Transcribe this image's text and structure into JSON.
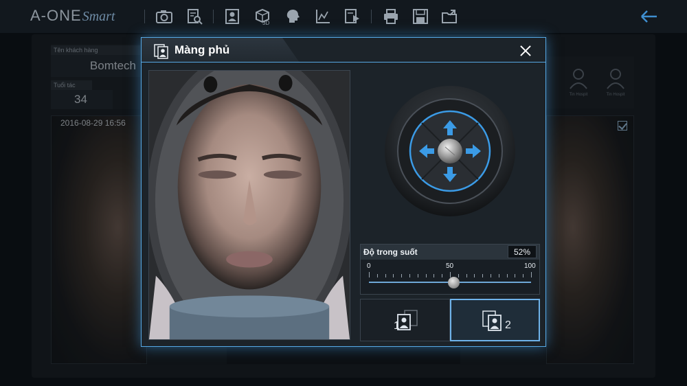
{
  "topbar": {
    "brand_main": "A-ONE",
    "brand_script": "Smart",
    "icons": [
      "camera-icon",
      "report-search-icon",
      "portrait-icon",
      "3d-cube-icon",
      "face-profile-icon",
      "chart-icon",
      "media-export-icon",
      "printer-icon",
      "save-icon",
      "open-folder-icon"
    ],
    "back_icon": "arrow-left-icon"
  },
  "background": {
    "customer_label": "Tên khách hàng",
    "customer_name": "Bomtech",
    "age_label": "Tuổi tác",
    "age_value": "34",
    "left_photo_date": "2016-08-29 16:56",
    "user_labels": [
      "Tin Hospit",
      "Tin Hospit"
    ]
  },
  "dialog": {
    "title": "Màng phủ",
    "title_icon": "overlay-portrait-icon",
    "close_icon": "close-icon",
    "joystick": {
      "arrows": [
        "arrow-up-icon",
        "arrow-left-icon",
        "arrow-right-icon",
        "arrow-down-icon"
      ],
      "accent": "#3b9be6"
    },
    "transparency": {
      "label": "Độ trong suốt",
      "value_text": "52%",
      "value": 52,
      "min_label": "0",
      "mid_label": "50",
      "max_label": "100"
    },
    "modes": [
      {
        "number": "1",
        "selected": false
      },
      {
        "number": "2",
        "selected": true
      }
    ],
    "colors": {
      "accent": "#56a9e6",
      "panel": "#1c2329"
    }
  }
}
